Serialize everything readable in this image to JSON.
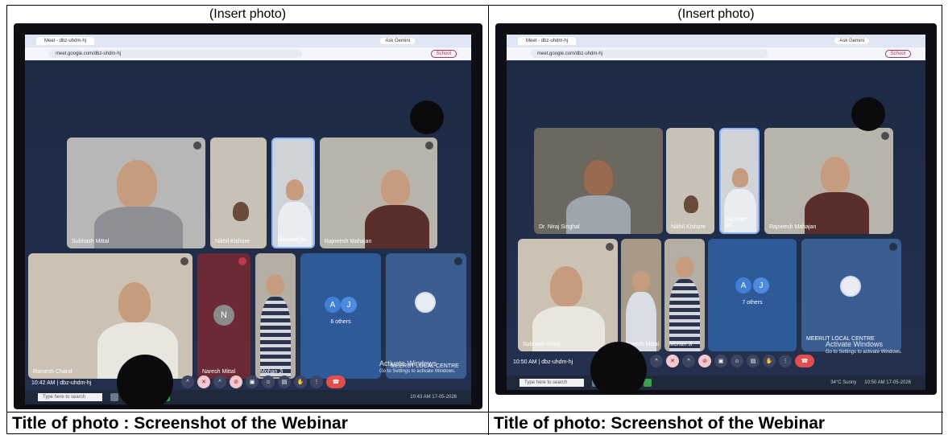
{
  "left": {
    "insert_label": "(Insert photo)",
    "caption": "Title of photo : Screenshot of the Webinar",
    "tab_title": "Meet - dbz-uhdm-hj",
    "url": "meet.google.com/dbz-uhdm-hj",
    "ask_gemini": "Ask Gemini",
    "school": "School",
    "participants": [
      "Subhash Mittal",
      "Nikhil Kishore",
      "Saurabh Mi...",
      "Rajneesh Mahajan",
      "Ramesh Chand",
      "Naresh Mittal",
      "Mohan Ji"
    ],
    "naresh_initial": "N",
    "others_initials": [
      "A",
      "J"
    ],
    "others_label": "6 others",
    "centre_label": "MEERUT LOCAL CENTRE",
    "meeting_info": "10:42 AM | dbz-uhdm-hj",
    "activate_title": "Activate Windows",
    "activate_sub": "Go to Settings to activate Windows.",
    "search_placeholder": "Type here to search",
    "tray_text": "10:43 AM 17-05-2026"
  },
  "right": {
    "insert_label": "(Insert photo)",
    "caption": "Title of photo: Screenshot of the Webinar",
    "tab_title": "Meet - dbz-uhdm-hj",
    "url": "meet.google.com/dbz-uhdm-hj",
    "ask_gemini": "Ask Gemini",
    "school": "School",
    "participants": [
      "Dr. Niraj Singhal",
      "Nikhil Kishore",
      "Saurabh Mi...",
      "Rajneesh Mahajan",
      "Subhash Mittal",
      "Naresh Mittal",
      "Mohan Ji"
    ],
    "others_initials": [
      "A",
      "J"
    ],
    "others_label": "7 others",
    "centre_label": "MEERUT LOCAL CENTRE",
    "meeting_info": "10:50 AM | dbz-uhdm-hj",
    "activate_title": "Activate Windows",
    "activate_sub": "Go to Settings to activate Windows.",
    "search_placeholder": "Type here to search",
    "weather": "34°C Sunny",
    "tray_text": "10:50 AM 17-05-2026"
  }
}
